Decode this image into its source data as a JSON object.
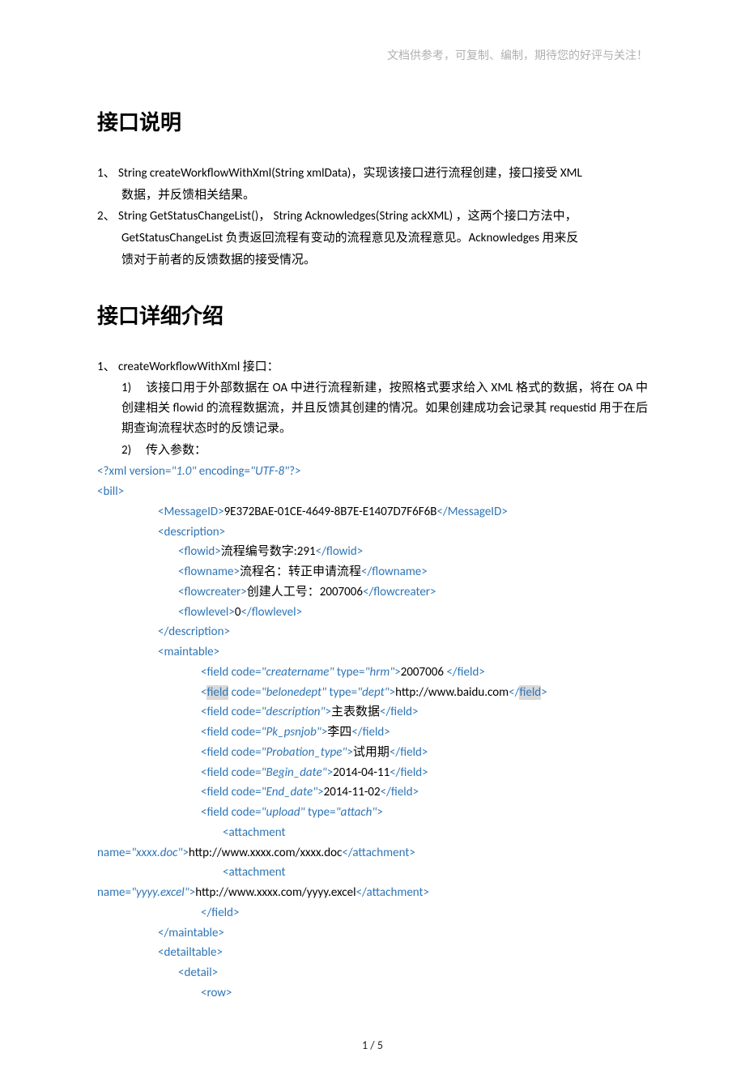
{
  "header_note": "文档供参考，可复制、编制，期待您的好评与关注！",
  "h1": "接口说明",
  "p1_pre": "1、 String createWorkflowWithXml(String xmlData)，实现该接口进行流程创建，接口接受 XML",
  "p1_cont": "数据，并反馈相关结果。",
  "p2_pre": "2、 String GetStatusChangeList()， String Acknowledges(String ackXML)  ，这两个接口方法中，",
  "p2_l2": "GetStatusChangeList 负责返回流程有变动的流程意见及流程意见。Acknowledges 用来反",
  "p2_l3": "馈对于前者的反馈数据的接受情况。",
  "h2": "接口详细介绍",
  "d1": "1、 createWorkflowWithXml 接口：",
  "d1_1": "该接口用于外部数据在 OA 中进行流程新建，按照格式要求给入 XML 格式的数据，将在 OA 中创建相关 flowid 的流程数据流，并且反馈其创建的情况。如果创建成功会记录其 requestid 用于在后期查询流程状态时的反馈记录。",
  "d1_2": "传入参数：",
  "xml": {
    "decl_a": "<?xml ",
    "decl_b": "version=",
    "decl_v1": "\"1.0\"",
    "decl_c": " encoding=",
    "decl_v2": "\"UTF-8\"",
    "decl_d": "?>",
    "bill_open": "<bill>",
    "msg_open": "<MessageID>",
    "msg_val": "9E372BAE-01CE-4649-8B7E-E1407D7F6F6B",
    "msg_close": "</MessageID>",
    "desc_open": "<description>",
    "flowid_o": "<flowid>",
    "flowid_v": "流程编号数字:291",
    "flowid_c": "</flowid>",
    "flowname_o": "<flowname>",
    "flowname_v": "流程名：转正申请流程",
    "flowname_c": "</flowname>",
    "flowcreater_o": "<flowcreater>",
    "flowcreater_v": "创建人工号：2007006",
    "flowcreater_c": "</flowcreater>",
    "flowlevel_o": "<flowlevel>",
    "flowlevel_v": "0",
    "flowlevel_c": "</flowlevel>",
    "desc_close": "</description>",
    "main_open": "<maintable>",
    "f1_o": "<field ",
    "f1_a": "code=",
    "f1_v1": "\"creatername\"",
    "f1_b": " type=",
    "f1_v2": "\"hrm\"",
    "f1_c": ">",
    "f1_val": "2007006 ",
    "f1_close": "</field>",
    "f2_o1": "<",
    "f2_hl1": "field",
    "f2_sp": " ",
    "f2_a": "code=",
    "f2_v1": "\"belonedept\"",
    "f2_b": " type=",
    "f2_v2": "\"dept\"",
    "f2_c": ">",
    "f2_val": "http://www.baidu.com",
    "f2_close1": "</",
    "f2_hl2": "field",
    "f2_close2": ">",
    "f3_o": "<field ",
    "f3_a": "code=",
    "f3_v1": "\"description\"",
    "f3_c": ">",
    "f3_val": "主表数据",
    "f3_close": "</field>",
    "f4_o": "<field ",
    "f4_a": "code=",
    "f4_v1": "\"Pk_psnjob\"",
    "f4_c": ">",
    "f4_val": "李四",
    "f4_close": "</field>",
    "f5_o": "<field ",
    "f5_a": "code=",
    "f5_v1": "\"Probation_type\"",
    "f5_c": ">",
    "f5_val": "试用期",
    "f5_close": "</field>",
    "f6_o": "<field ",
    "f6_a": "code=",
    "f6_v1": "\"Begin_date\"",
    "f6_c": ">",
    "f6_val": "2014-04-11",
    "f6_close": "</field>",
    "f7_o": "<field ",
    "f7_a": "code=",
    "f7_v1": "\"End_date\"",
    "f7_c": ">",
    "f7_val": "2014-11-02",
    "f7_close": "</field>",
    "f8_o": "<field ",
    "f8_a": "code=",
    "f8_v1": "\"upload\"",
    "f8_b": " type=",
    "f8_v2": "\"attach\"",
    "f8_c": ">",
    "att1_o": "<attachment",
    "att1_nl": "name=",
    "att1_v": "\"xxxx.doc\"",
    "att1_c": ">",
    "att1_val": "http://www.xxxx.com/xxxx.doc",
    "att1_close": "</attachment>",
    "att2_o": "<attachment",
    "att2_nl": "name=",
    "att2_v": "\"yyyy.excel\"",
    "att2_c": ">",
    "att2_val": "http://www.xxxx.com/yyyy.excel",
    "att2_close": "</attachment>",
    "field_close": "</field>",
    "main_close": "</maintable>",
    "dt_open": "<detailtable>",
    "detail_open": "<detail>",
    "row_open": "<row>"
  },
  "pagenum": "1  /  5"
}
